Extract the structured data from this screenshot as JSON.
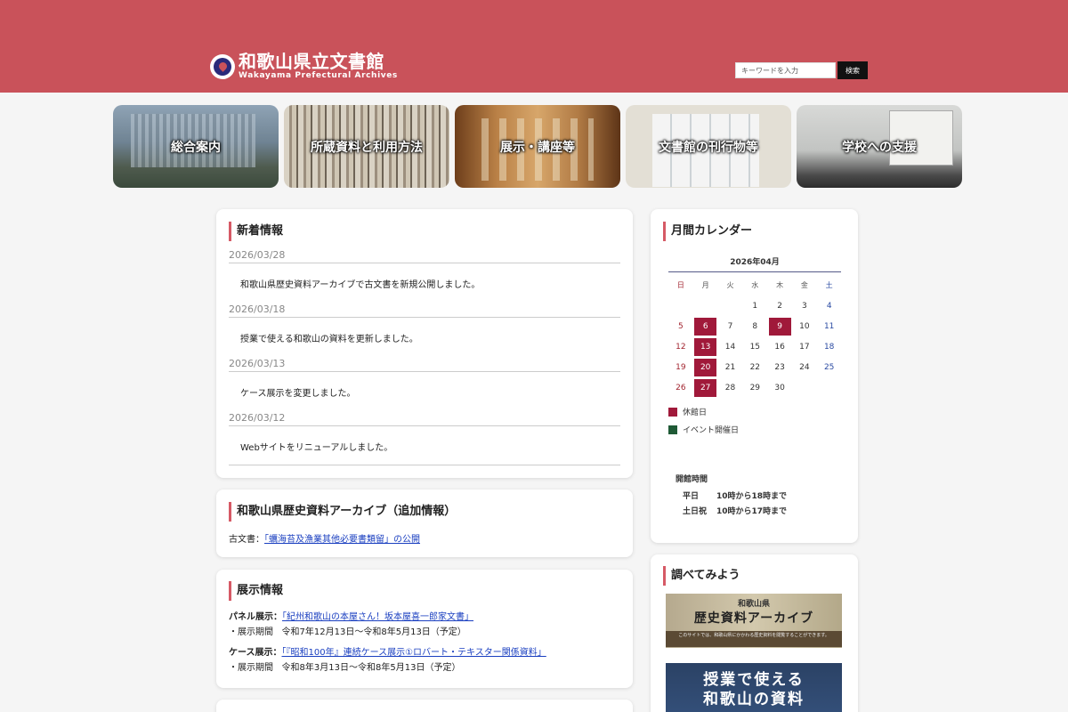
{
  "header": {
    "logo_jp": "和歌山県立文書館",
    "logo_en": "Wakayama Prefectural Archives",
    "search_placeholder": "キーワードを入力",
    "search_button": "検索",
    "bg_color": "#c9525a"
  },
  "nav": [
    {
      "label": "総合案内"
    },
    {
      "label": "所蔵資料と利用方法"
    },
    {
      "label": "展示・講座等"
    },
    {
      "label": "文書館の刊行物等"
    },
    {
      "label": "学校への支援"
    }
  ],
  "news": {
    "title": "新着情報",
    "items": [
      {
        "date": "2026/03/28",
        "text": "和歌山県歴史資料アーカイブで古文書を新規公開しました。"
      },
      {
        "date": "2026/03/18",
        "text": "授業で使える和歌山の資料を更新しました。"
      },
      {
        "date": "2026/03/13",
        "text": "ケース展示を変更しました。"
      },
      {
        "date": "2026/03/12",
        "text": "Webサイトをリニューアルしました。"
      }
    ]
  },
  "archive": {
    "title": "和歌山県歴史資料アーカイブ（追加情報）",
    "prefix": "古文書：",
    "link": "「蠣海苔及漁業其他必要書類留」の公開"
  },
  "exhibit": {
    "title": "展示情報",
    "panel_prefix": "パネル展示：",
    "panel_link": "「紀州和歌山の本屋さん！坂本屋喜一郎家文書」",
    "panel_period_label": "・展示期間",
    "panel_period": "令和7年12月13日～令和8年5月13日（予定）",
    "case_prefix": "ケース展示：",
    "case_link": "「『昭和100年』連続ケース展示①ロバート・テキスター関係資料」",
    "case_period_label": "・展示期間",
    "case_period": "令和8年3月13日～令和8年5月13日（予定）"
  },
  "calendar": {
    "title": "月間カレンダー",
    "month": "2026年04月",
    "weekdays": [
      "日",
      "月",
      "火",
      "水",
      "木",
      "金",
      "土"
    ],
    "weeks": [
      [
        "",
        "",
        "",
        "1",
        "2",
        "3",
        "4"
      ],
      [
        "5",
        "6",
        "7",
        "8",
        "9",
        "10",
        "11"
      ],
      [
        "12",
        "13",
        "14",
        "15",
        "16",
        "17",
        "18"
      ],
      [
        "19",
        "20",
        "21",
        "22",
        "23",
        "24",
        "25"
      ],
      [
        "26",
        "27",
        "28",
        "29",
        "30",
        "",
        ""
      ]
    ],
    "closed_days": [
      "6",
      "9",
      "13",
      "20",
      "27"
    ],
    "closed_color": "#a0193a",
    "event_color": "#1f5a36",
    "legend_closed": "休館日",
    "legend_event": "イベント開催日",
    "hours_title": "開館時間",
    "hours": [
      {
        "day": "平日",
        "time": "10時から18時まで"
      },
      {
        "day": "土日祝",
        "time": "10時から17時まで"
      }
    ]
  },
  "research": {
    "title": "調べてみよう",
    "banner1_top": "和歌山県",
    "banner1_main": "歴史資料アーカイブ",
    "banner1_note": "このサイトでは、和歌山県にかかわる歴史資料を閲覧することができます。",
    "banner2_line1": "授業で使える",
    "banner2_line2": "和歌山の資料"
  }
}
